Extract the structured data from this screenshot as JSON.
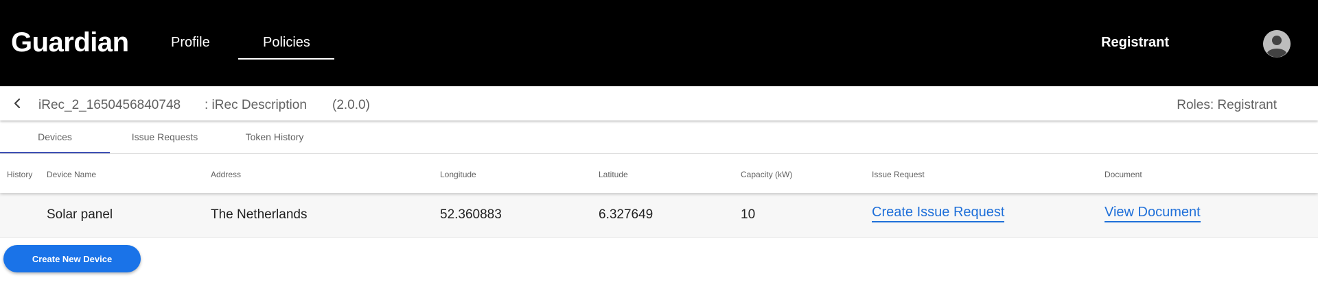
{
  "app": {
    "title": "Guardian"
  },
  "nav": {
    "items": [
      {
        "label": "Profile",
        "active": false
      },
      {
        "label": "Policies",
        "active": true
      }
    ]
  },
  "user": {
    "name": "Registrant",
    "avatar_icon": "account-circle-icon"
  },
  "policy": {
    "name": "iRec_2_1650456840748",
    "description": ": iRec Description",
    "version": "(2.0.0)",
    "roles": "Roles: Registrant"
  },
  "tabs": [
    {
      "label": "Devices",
      "active": true
    },
    {
      "label": "Issue Requests",
      "active": false
    },
    {
      "label": "Token History",
      "active": false
    }
  ],
  "table": {
    "columns": [
      "History",
      "Device Name",
      "Address",
      "Longitude",
      "Latitude",
      "Capacity (kW)",
      "Issue Request",
      "Document"
    ],
    "rows": [
      {
        "history": "",
        "device_name": "Solar panel",
        "address": "The Netherlands",
        "longitude": "52.360883",
        "latitude": "6.327649",
        "capacity": "10",
        "issue_request": "Create Issue Request",
        "document": "View Document"
      }
    ]
  },
  "actions": {
    "create_device": "Create New Device"
  },
  "colors": {
    "header_bg": "#000000",
    "link": "#1e6fd9",
    "primary_button": "#1a73e8",
    "tab_indicator": "#3f51b5",
    "row_bg": "#f7f7f7"
  }
}
